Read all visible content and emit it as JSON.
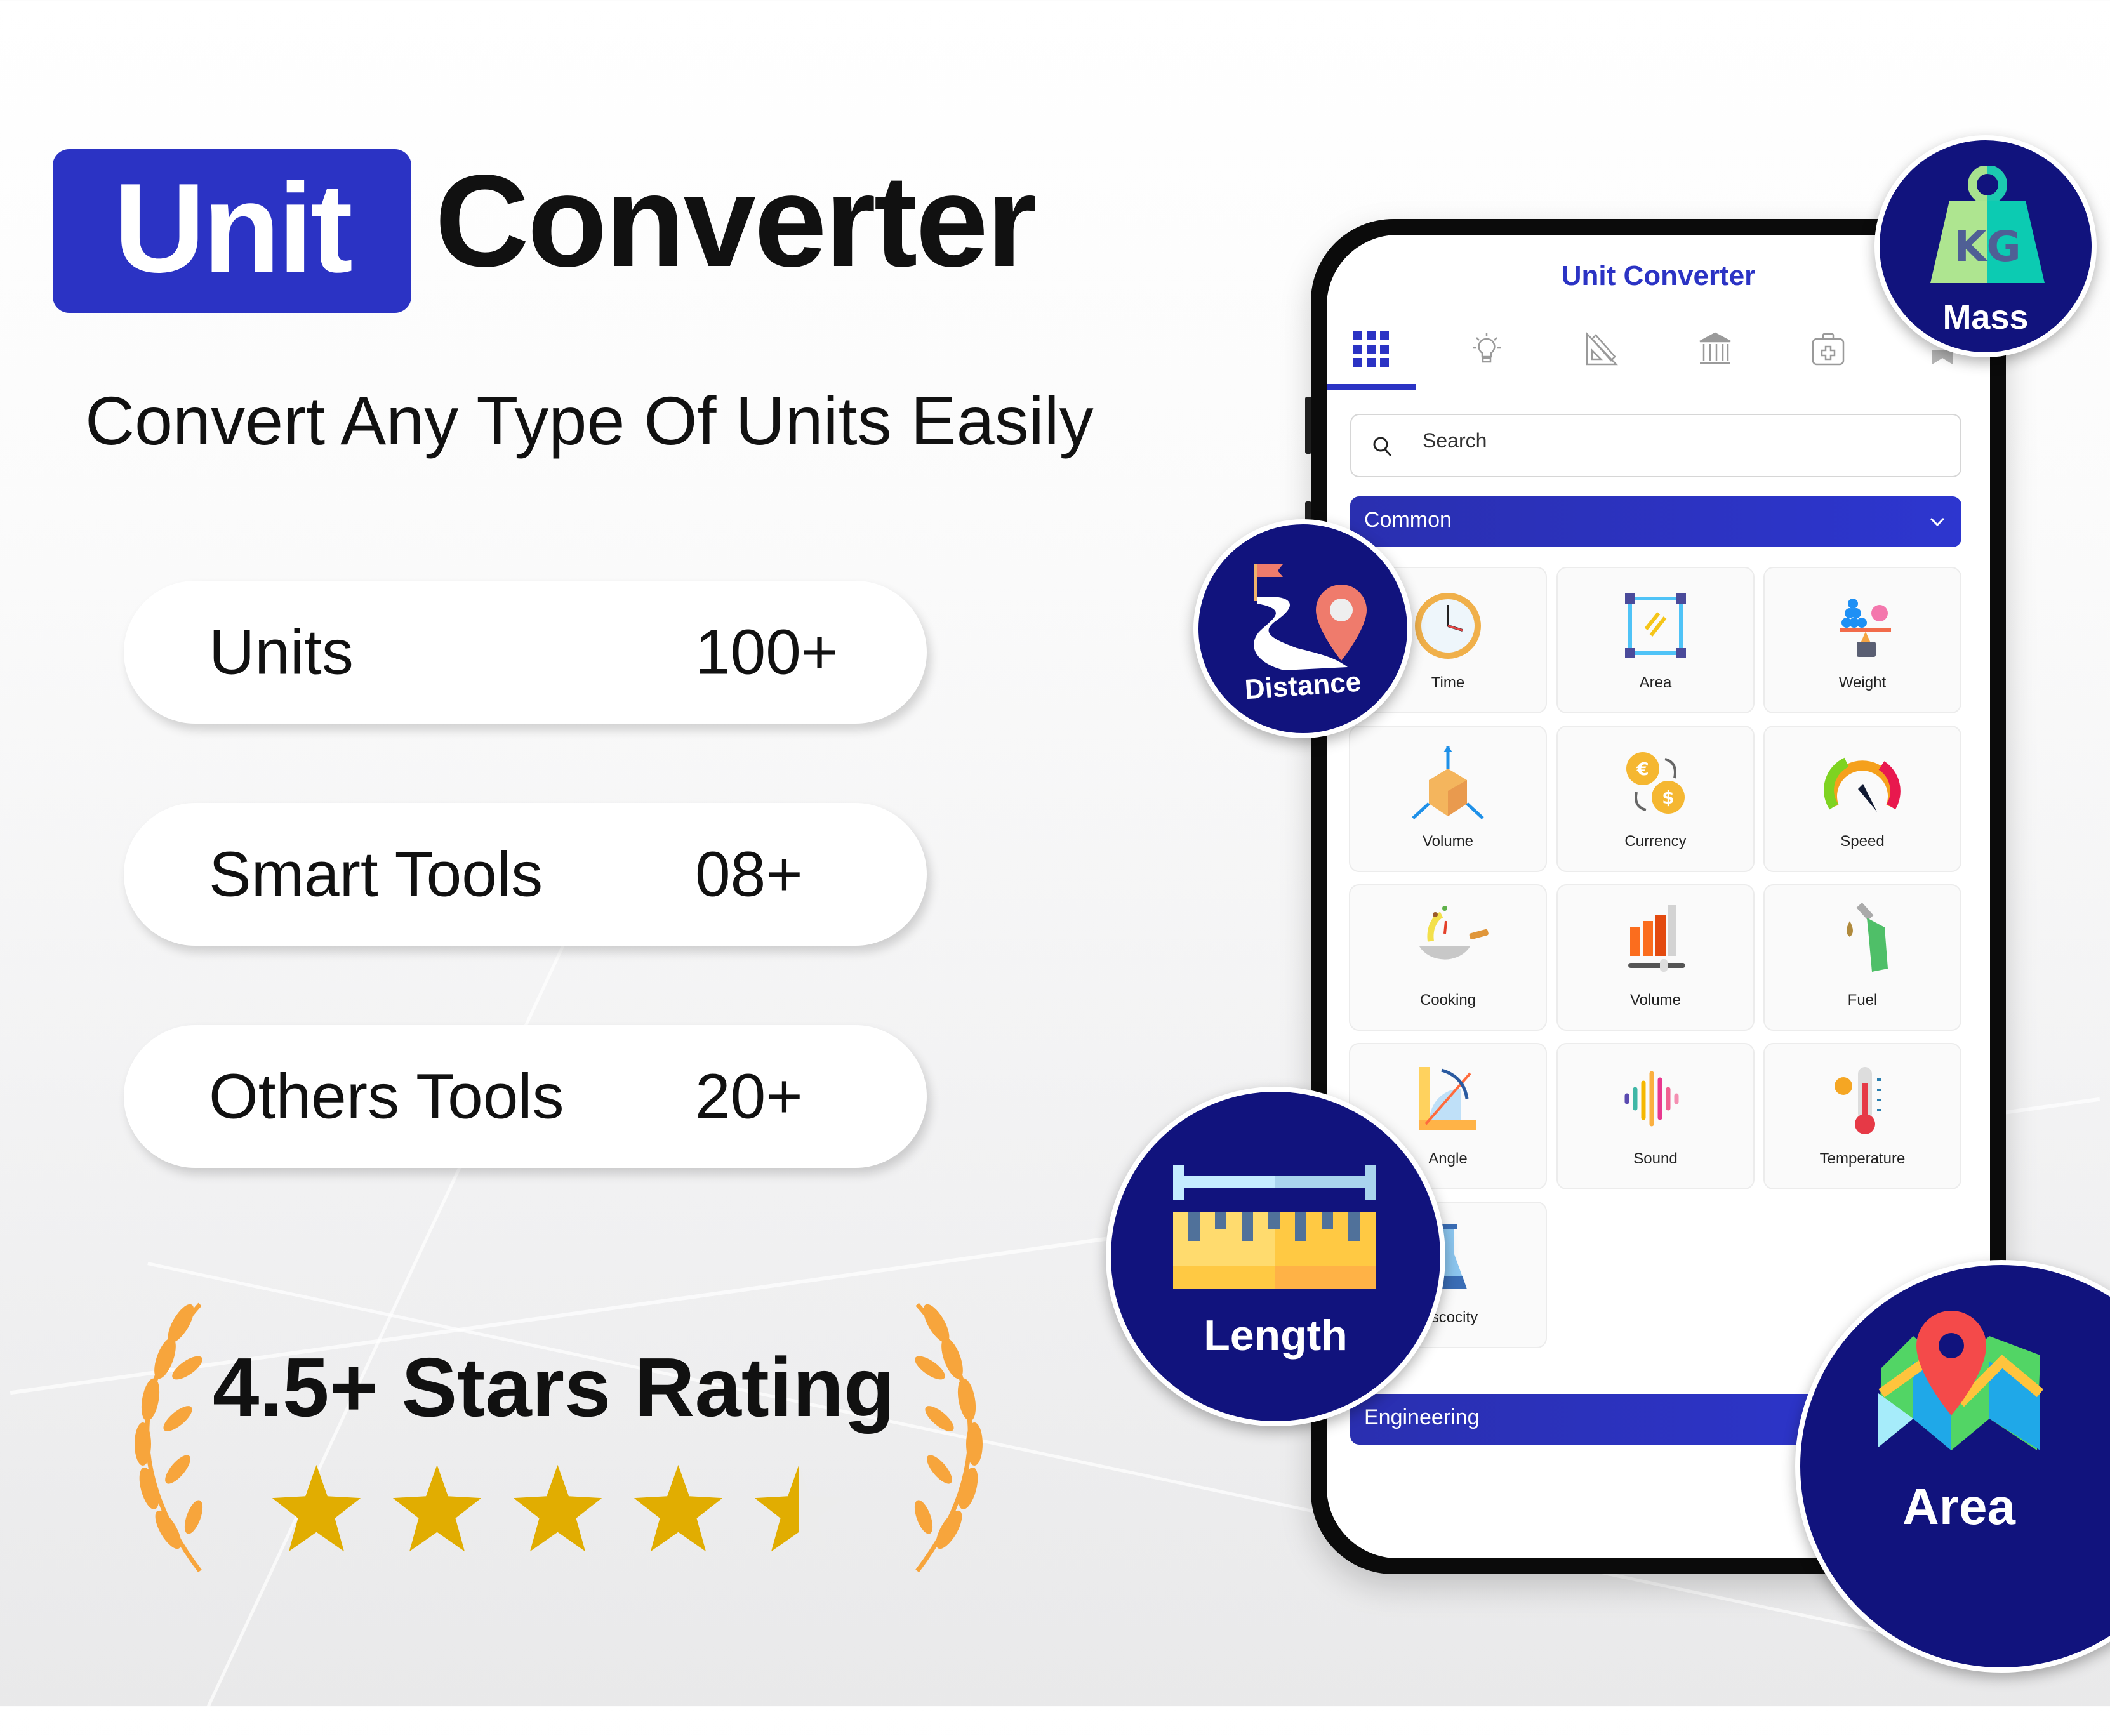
{
  "headline": {
    "highlight": "Unit",
    "rest": "Converter",
    "subtitle": "Convert Any Type Of Units Easily",
    "highlight_color": "#2b33c4"
  },
  "stats": [
    {
      "label": "Units",
      "value": "100+"
    },
    {
      "label": "Smart Tools",
      "value": "08+"
    },
    {
      "label": "Others Tools",
      "value": "20+"
    }
  ],
  "rating": {
    "text": "4.5+ Stars Rating",
    "stars_value": 4.5,
    "stars_max": 5,
    "star_color": "#e1ad01",
    "laurel_color": "#f7a53c"
  },
  "app": {
    "title": "Unit Converter",
    "accent": "#2b33c4",
    "tabs": [
      {
        "icon": "grid-icon",
        "active": true
      },
      {
        "icon": "lightbulb-icon",
        "active": false
      },
      {
        "icon": "ruler-triangle-icon",
        "active": false
      },
      {
        "icon": "bank-icon",
        "active": false
      },
      {
        "icon": "first-aid-kit-icon",
        "active": false
      },
      {
        "icon": "bookmark-icon",
        "active": false
      }
    ],
    "search_placeholder": "Search",
    "sections": [
      {
        "title": "Common",
        "expanded": true,
        "items": [
          {
            "label": "Time",
            "icon": "clock-icon"
          },
          {
            "label": "Area",
            "icon": "area-frame-icon"
          },
          {
            "label": "Weight",
            "icon": "balance-scale-icon"
          },
          {
            "label": "Volume",
            "icon": "cube-axes-icon"
          },
          {
            "label": "Currency",
            "icon": "currency-exchange-icon"
          },
          {
            "label": "Speed",
            "icon": "speedometer-icon"
          },
          {
            "label": "Cooking",
            "icon": "wok-icon"
          },
          {
            "label": "Volume",
            "icon": "volume-bars-icon"
          },
          {
            "label": "Fuel",
            "icon": "fuel-nozzle-icon"
          },
          {
            "label": "Angle",
            "icon": "protractor-icon"
          },
          {
            "label": "Sound",
            "icon": "sound-wave-icon"
          },
          {
            "label": "Temperature",
            "icon": "thermometer-icon"
          },
          {
            "label": "Viscocity",
            "icon": "flask-icon"
          }
        ]
      },
      {
        "title": "Engineering",
        "expanded": false
      }
    ]
  },
  "badges": [
    {
      "label": "Mass",
      "icon": "kg-weight-icon"
    },
    {
      "label": "Distance",
      "icon": "route-pin-icon"
    },
    {
      "label": "Length",
      "icon": "ruler-icon"
    },
    {
      "label": "Area",
      "icon": "map-pin-icon"
    }
  ]
}
